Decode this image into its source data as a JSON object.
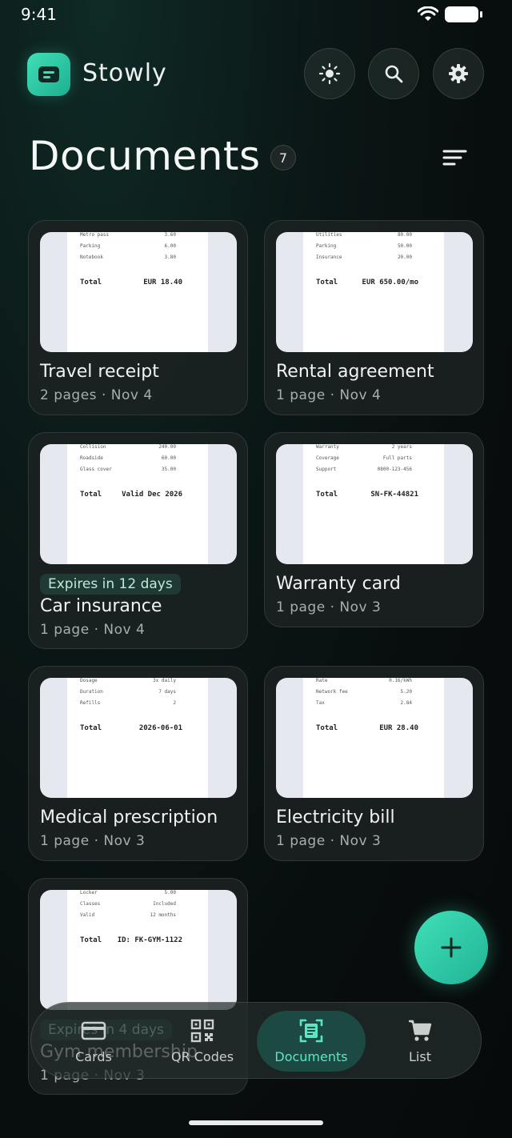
{
  "status": {
    "time": "9:41"
  },
  "header": {
    "app_name": "Stowly",
    "logo_icon": "document-icon",
    "buttons": [
      "theme-icon",
      "search-icon",
      "settings-icon"
    ]
  },
  "page": {
    "title": "Documents",
    "count": "7"
  },
  "documents": [
    {
      "title": "Travel receipt",
      "meta": "2 pages · Nov 4",
      "expiry": "",
      "thumb": {
        "lines": [
          [
            "Metro pass",
            "3.60"
          ],
          [
            "Parking",
            "6.00"
          ],
          [
            "Notebook",
            "3.80"
          ]
        ],
        "total_label": "Total",
        "total_value": "EUR 18.40"
      }
    },
    {
      "title": "Rental agreement",
      "meta": "1 page · Nov 4",
      "expiry": "",
      "thumb": {
        "lines": [
          [
            "Utilities",
            "80.00"
          ],
          [
            "Parking",
            "50.00"
          ],
          [
            "Insurance",
            "20.00"
          ]
        ],
        "total_label": "Total",
        "total_value": "EUR 650.00/mo"
      }
    },
    {
      "title": "Car insurance",
      "meta": "1 page · Nov 4",
      "expiry": "Expires in 12 days",
      "thumb": {
        "lines": [
          [
            "Collision",
            "240.00"
          ],
          [
            "Roadside",
            "60.00"
          ],
          [
            "Glass cover",
            "35.00"
          ]
        ],
        "total_label": "Total",
        "total_value": "Valid Dec 2026"
      }
    },
    {
      "title": "Warranty card",
      "meta": "1 page · Nov 3",
      "expiry": "",
      "thumb": {
        "lines": [
          [
            "Warranty",
            "2 years"
          ],
          [
            "Coverage",
            "Full parts"
          ],
          [
            "Support",
            "0800-123-456"
          ]
        ],
        "total_label": "Total",
        "total_value": "SN-FK-44821"
      }
    },
    {
      "title": "Medical prescription",
      "meta": "1 page · Nov 3",
      "expiry": "",
      "thumb": {
        "lines": [
          [
            "Dosage",
            "3x daily"
          ],
          [
            "Duration",
            "7 days"
          ],
          [
            "Refills",
            "2"
          ]
        ],
        "total_label": "Total",
        "total_value": "2026-06-01"
      }
    },
    {
      "title": "Electricity bill",
      "meta": "1 page · Nov 3",
      "expiry": "",
      "thumb": {
        "lines": [
          [
            "Rate",
            "0.16/kWh"
          ],
          [
            "Network fee",
            "5.20"
          ],
          [
            "Tax",
            "2.84"
          ]
        ],
        "total_label": "Total",
        "total_value": "EUR 28.40"
      }
    },
    {
      "title": "Gym membership",
      "meta": "1 page · Nov 3",
      "expiry": "Expires in 4 days",
      "thumb": {
        "lines": [
          [
            "Locker",
            "5.00"
          ],
          [
            "Classes",
            "Included"
          ],
          [
            "Valid",
            "12 months"
          ]
        ],
        "total_label": "Total",
        "total_value": "ID: FK-GYM-1122"
      }
    }
  ],
  "fab": {
    "icon": "plus-icon"
  },
  "nav": {
    "items": [
      {
        "label": "Cards",
        "icon": "card-icon",
        "active": false
      },
      {
        "label": "QR Codes",
        "icon": "qr-code-icon",
        "active": false
      },
      {
        "label": "Documents",
        "icon": "document-scan-icon",
        "active": true
      },
      {
        "label": "List",
        "icon": "cart-icon",
        "active": false
      }
    ]
  }
}
